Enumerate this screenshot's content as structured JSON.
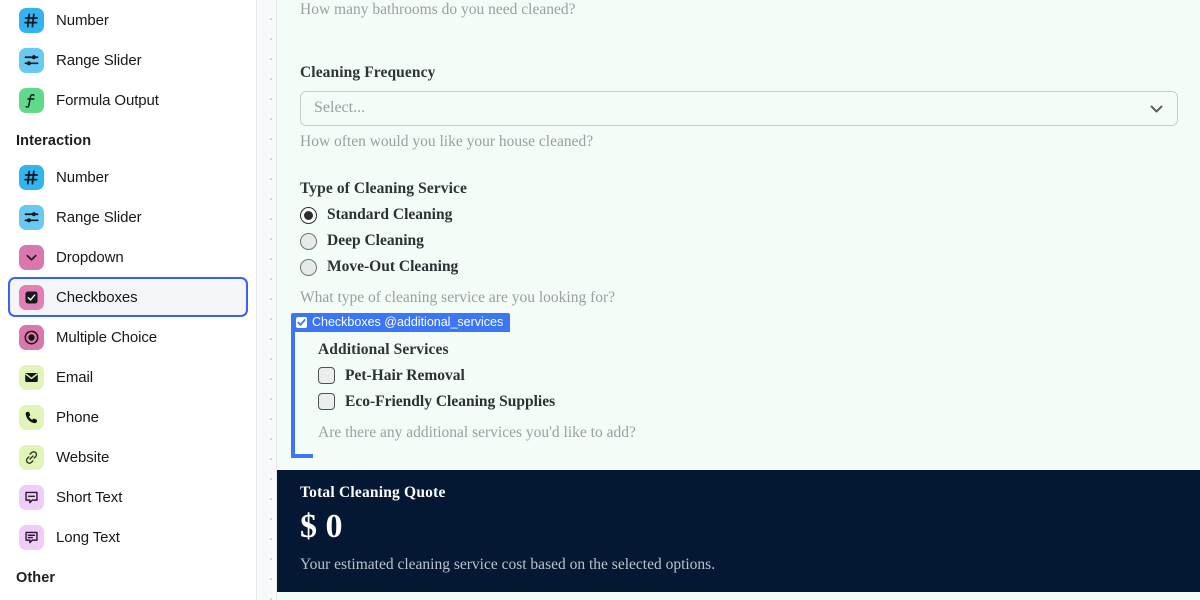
{
  "sidebar": {
    "groups": [
      {
        "title": null,
        "items": [
          {
            "label": "Number",
            "icon": "hash-icon",
            "icon_color": "#31b4ef",
            "selected": false
          },
          {
            "label": "Range Slider",
            "icon": "sliders-icon",
            "icon_color": "#69c9f2",
            "selected": false
          },
          {
            "label": "Formula Output",
            "icon": "function-icon",
            "icon_color": "#5fd98a",
            "selected": false
          }
        ]
      },
      {
        "title": "Interaction",
        "items": [
          {
            "label": "Number",
            "icon": "hash-icon",
            "icon_color": "#31b4ef",
            "selected": false
          },
          {
            "label": "Range Slider",
            "icon": "sliders-icon",
            "icon_color": "#69c9f2",
            "selected": false
          },
          {
            "label": "Dropdown",
            "icon": "chevron-down-icon",
            "icon_color": "#d878ae",
            "selected": false
          },
          {
            "label": "Checkboxes",
            "icon": "checkbox-icon",
            "icon_color": "#e27fb4",
            "selected": true
          },
          {
            "label": "Multiple Choice",
            "icon": "radio-icon",
            "icon_color": "#d878ae",
            "selected": false
          },
          {
            "label": "Email",
            "icon": "envelope-icon",
            "icon_color": "#e2f5b9",
            "selected": false
          },
          {
            "label": "Phone",
            "icon": "phone-icon",
            "icon_color": "#e2f5b9",
            "selected": false
          },
          {
            "label": "Website",
            "icon": "link-icon",
            "icon_color": "#e2f5b9",
            "selected": false
          },
          {
            "label": "Short Text",
            "icon": "short-text-icon",
            "icon_color": "#f0ccf8",
            "selected": false
          },
          {
            "label": "Long Text",
            "icon": "long-text-icon",
            "icon_color": "#f0ccf8",
            "selected": false
          }
        ]
      },
      {
        "title": "Other",
        "items": []
      }
    ]
  },
  "canvas": {
    "bathrooms_helper": "How many bathrooms do you need cleaned?",
    "frequency": {
      "label": "Cleaning Frequency",
      "placeholder": "Select...",
      "helper": "How often would you like your house cleaned?",
      "chevron": "chevron-down"
    },
    "service_type": {
      "label": "Type of Cleaning Service",
      "helper": "What type of cleaning service are you looking for?",
      "options": [
        {
          "label": "Standard Cleaning",
          "checked": true
        },
        {
          "label": "Deep Cleaning",
          "checked": false
        },
        {
          "label": "Move-Out Cleaning",
          "checked": false
        }
      ]
    },
    "additional_services": {
      "selection_tag": "Checkboxes @additional_services",
      "label": "Additional Services",
      "helper": "Are there any additional services you'd like to add?",
      "options": [
        {
          "label": "Pet-Hair Removal",
          "checked": false
        },
        {
          "label": "Eco-Friendly Cleaning Supplies",
          "checked": false
        }
      ]
    },
    "quote": {
      "title": "Total Cleaning Quote",
      "amount": "$ 0",
      "helper": "Your estimated cleaning service cost based on the selected options."
    }
  },
  "colors": {
    "accent": "#3b76f6",
    "canvas_bg": "#f3fcf6",
    "quote_bg": "#051833"
  }
}
